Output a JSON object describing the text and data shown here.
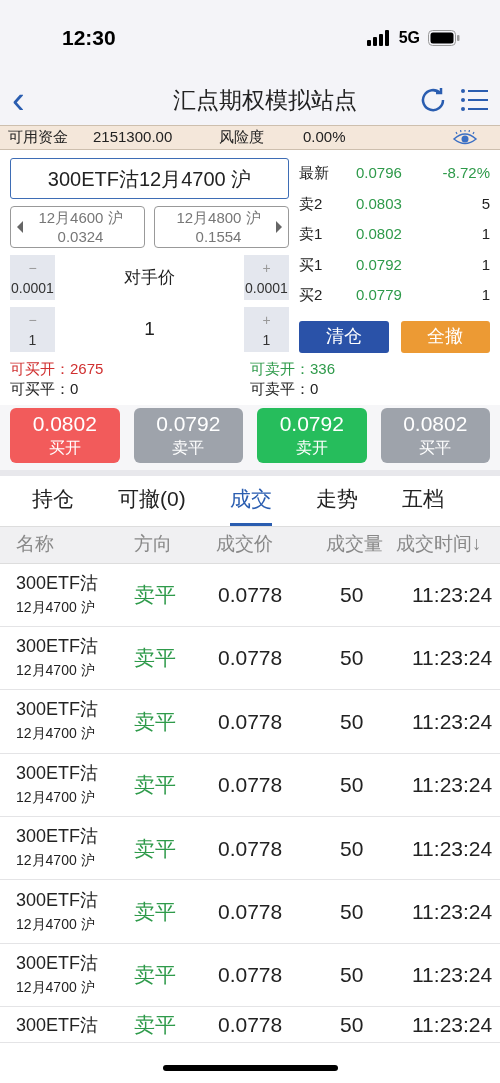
{
  "status_bar": {
    "time": "12:30",
    "network": "5G"
  },
  "nav": {
    "back": "‹",
    "title": "汇点期权模拟站点"
  },
  "account": {
    "funds_label": "可用资金",
    "funds": "2151300.00",
    "risk_label": "风险度",
    "risk": "0.00%"
  },
  "contract": {
    "name": "300ETF沽12月4700 沪",
    "prev": {
      "name": "12月4600 沪",
      "price": "0.0324"
    },
    "next": {
      "name": "12月4800 沪",
      "price": "0.1554"
    }
  },
  "price_stepper": {
    "minus": "−",
    "minus_step": "0.0001",
    "value": "对手价",
    "plus": "+",
    "plus_step": "0.0001"
  },
  "qty_stepper": {
    "minus": "−",
    "minus_step": "1",
    "value": "1",
    "plus": "+",
    "plus_step": "1"
  },
  "quotes": [
    {
      "label": "最新",
      "price": "0.0796",
      "extra": "-8.72%",
      "kind": "change"
    },
    {
      "label": "卖2",
      "price": "0.0803",
      "extra": "5",
      "kind": "volume"
    },
    {
      "label": "卖1",
      "price": "0.0802",
      "extra": "1",
      "kind": "volume"
    },
    {
      "label": "买1",
      "price": "0.0792",
      "extra": "1",
      "kind": "volume"
    },
    {
      "label": "买2",
      "price": "0.0779",
      "extra": "1",
      "kind": "volume"
    }
  ],
  "actions": [
    {
      "label": "清仓",
      "color": "#2a52a8"
    },
    {
      "label": "全撤",
      "color": "#ec9a34"
    }
  ],
  "availability": [
    {
      "label": "可买开：",
      "value": "2675",
      "kind": "buy"
    },
    {
      "label": "可卖开：",
      "value": "336",
      "kind": "sell"
    },
    {
      "label": "可买平：",
      "value": "0",
      "kind": "plain"
    },
    {
      "label": "可卖平：",
      "value": "0",
      "kind": "plain"
    }
  ],
  "trade_buttons": [
    {
      "price": "0.0802",
      "label": "买开",
      "color": "#f25b5b"
    },
    {
      "price": "0.0792",
      "label": "卖平",
      "color": "#9ea3ab"
    },
    {
      "price": "0.0792",
      "label": "卖开",
      "color": "#26bd5c"
    },
    {
      "price": "0.0802",
      "label": "买平",
      "color": "#9ea3ab"
    }
  ],
  "tabs": [
    {
      "label": "持仓",
      "selected": false
    },
    {
      "label": "可撤(0)",
      "selected": false
    },
    {
      "label": "成交",
      "selected": true
    },
    {
      "label": "走势",
      "selected": false
    },
    {
      "label": "五档",
      "selected": false
    }
  ],
  "table": {
    "columns": [
      "名称",
      "方向",
      "成交价",
      "成交量",
      "成交时间↓"
    ],
    "rows": [
      {
        "name": "300ETF沽",
        "sub": "12月4700 沪",
        "direction": "卖平",
        "price": "0.0778",
        "volume": "50",
        "time": "11:23:24"
      },
      {
        "name": "300ETF沽",
        "sub": "12月4700 沪",
        "direction": "卖平",
        "price": "0.0778",
        "volume": "50",
        "time": "11:23:24"
      },
      {
        "name": "300ETF沽",
        "sub": "12月4700 沪",
        "direction": "卖平",
        "price": "0.0778",
        "volume": "50",
        "time": "11:23:24"
      },
      {
        "name": "300ETF沽",
        "sub": "12月4700 沪",
        "direction": "卖平",
        "price": "0.0778",
        "volume": "50",
        "time": "11:23:24"
      },
      {
        "name": "300ETF沽",
        "sub": "12月4700 沪",
        "direction": "卖平",
        "price": "0.0778",
        "volume": "50",
        "time": "11:23:24"
      },
      {
        "name": "300ETF沽",
        "sub": "12月4700 沪",
        "direction": "卖平",
        "price": "0.0778",
        "volume": "50",
        "time": "11:23:24"
      },
      {
        "name": "300ETF沽",
        "sub": "12月4700 沪",
        "direction": "卖平",
        "price": "0.0778",
        "volume": "50",
        "time": "11:23:24"
      },
      {
        "name": "300ETF沽",
        "direction": "卖平",
        "price": "0.0778",
        "volume": "50",
        "time": "11:23:24"
      }
    ]
  }
}
